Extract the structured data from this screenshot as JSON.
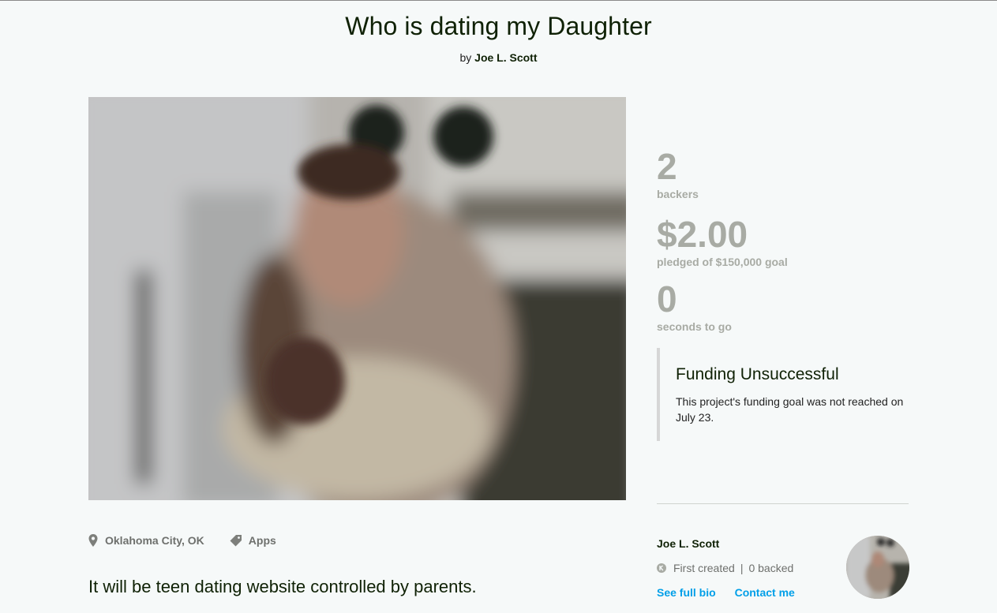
{
  "project": {
    "title": "Who is dating my Daughter",
    "by_prefix": "by",
    "creator": "Joe L. Scott"
  },
  "stats": {
    "backers_count": "2",
    "backers_label": "backers",
    "pledged_amount": "$2.00",
    "pledged_label": "pledged of $150,000 goal",
    "time_value": "0",
    "time_label": "seconds to go"
  },
  "funding": {
    "title": "Funding Unsuccessful",
    "text": "This project's funding goal was not reached on July 23."
  },
  "meta": {
    "location": "Oklahoma City, OK",
    "category": "Apps",
    "location_icon": "map-pin-icon",
    "category_icon": "tag-icon"
  },
  "blurb": "It will be teen dating website controlled by parents.",
  "creator_card": {
    "name": "Joe L. Scott",
    "created_label": "First created",
    "separator": "|",
    "backed_label": "0 backed",
    "created_icon": "kickstarter-k-icon",
    "see_bio": "See full bio",
    "contact": "Contact me"
  },
  "colors": {
    "accent_link": "#009fe8",
    "stat_gray": "#a8aba4",
    "text_dark": "#0f2105"
  }
}
